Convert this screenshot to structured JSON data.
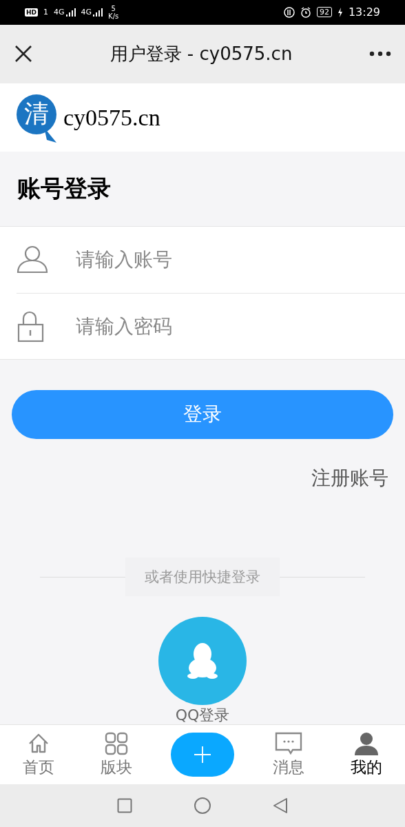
{
  "status_bar": {
    "hd": "HD",
    "sim": "1",
    "network_1": "4G",
    "network_2": "4G",
    "speed_value": "5",
    "speed_unit": "K/s",
    "battery": "92",
    "time": "13:29"
  },
  "nav_bar": {
    "title": "用户登录 - cy0575.cn"
  },
  "site": {
    "logo_mark": "清",
    "name": "cy0575.cn"
  },
  "heading": "账号登录",
  "fields": [
    {
      "kind": "user",
      "placeholder": "请输入账号"
    },
    {
      "kind": "lock",
      "placeholder": "请输入密码"
    }
  ],
  "login_button": "登录",
  "register_link": "注册账号",
  "quick_login": {
    "label": "或者使用快捷登录",
    "providers": [
      {
        "label": "QQ登录"
      }
    ]
  },
  "tab_bar": {
    "items": [
      {
        "kind": "home",
        "label": "首页",
        "selected": false
      },
      {
        "kind": "grid",
        "label": "版块",
        "selected": false
      },
      {
        "kind": "add"
      },
      {
        "kind": "message",
        "label": "消息",
        "selected": false
      },
      {
        "kind": "person",
        "label": "我的",
        "selected": true
      }
    ]
  }
}
